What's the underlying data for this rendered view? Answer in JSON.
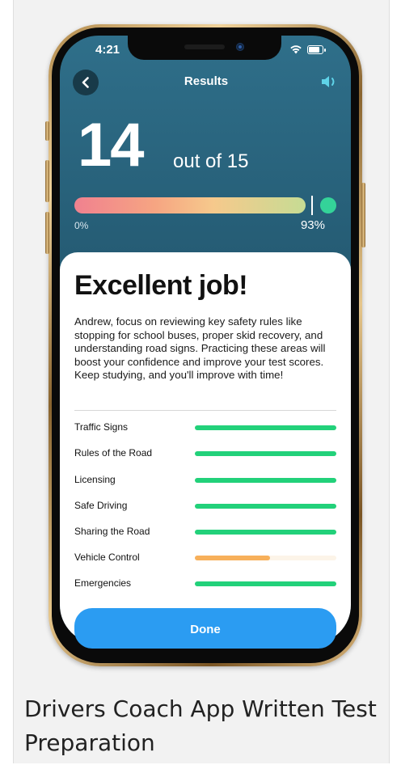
{
  "status_bar": {
    "time": "4:21"
  },
  "nav": {
    "title": "Results",
    "back_icon": "chevron-left-icon",
    "sound_icon": "speaker-icon"
  },
  "score": {
    "correct": "14",
    "out_of_text": "out of 15",
    "progress_min_label": "0%",
    "progress_percent_label": "93%",
    "progress_fraction": 0.93
  },
  "sheet": {
    "headline": "Excellent job!",
    "advice": "Andrew, focus on reviewing key safety rules like stopping for school buses, proper skid recovery, and understanding road signs. Practicing these areas will boost your confidence and improve your test scores. Keep studying, and you'll improve with time!",
    "categories": [
      {
        "label": "Traffic Signs",
        "fraction": 1.0,
        "color": "#22d17a"
      },
      {
        "label": "Rules of the Road",
        "fraction": 1.0,
        "color": "#22d17a"
      },
      {
        "label": "Licensing",
        "fraction": 1.0,
        "color": "#22d17a"
      },
      {
        "label": "Safe Driving",
        "fraction": 1.0,
        "color": "#22d17a"
      },
      {
        "label": "Sharing the Road",
        "fraction": 1.0,
        "color": "#22d17a"
      },
      {
        "label": "Vehicle Control",
        "fraction": 0.53,
        "color": "#f7b05b"
      },
      {
        "label": "Emergencies",
        "fraction": 1.0,
        "color": "#22d17a"
      }
    ],
    "done_label": "Done"
  },
  "caption": "Drivers Coach App Written Test Preparation",
  "colors": {
    "accent_blue": "#2b9cf2",
    "good_green": "#22d17a",
    "warn_orange": "#f7b05b",
    "header_teal": "#2f6f8a"
  }
}
